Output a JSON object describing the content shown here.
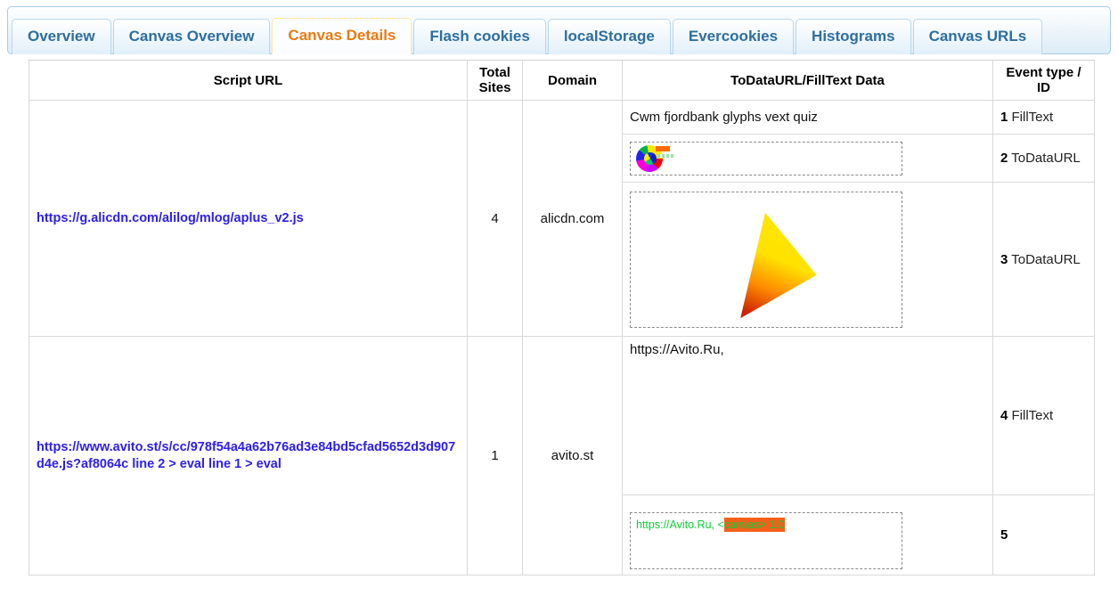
{
  "tabs": [
    {
      "label": "Overview",
      "selected": false
    },
    {
      "label": "Canvas Overview",
      "selected": false
    },
    {
      "label": "Canvas Details",
      "selected": true
    },
    {
      "label": "Flash cookies",
      "selected": false
    },
    {
      "label": "localStorage",
      "selected": false
    },
    {
      "label": "Evercookies",
      "selected": false
    },
    {
      "label": "Histograms",
      "selected": false
    },
    {
      "label": "Canvas URLs",
      "selected": false
    }
  ],
  "table": {
    "headers": {
      "script_url": "Script URL",
      "total_sites": "Total Sites",
      "domain": "Domain",
      "data": "ToDataURL/FillText Data",
      "event": "Event type / ID"
    },
    "groups": [
      {
        "script_url": "https://g.alicdn.com/alilog/mlog/aplus_v2.js",
        "total_sites": "4",
        "domain": "alicdn.com",
        "events": [
          {
            "id": "1",
            "type": "FillText",
            "kind": "text",
            "text": "Cwm fjordbank glyphs vext quiz"
          },
          {
            "id": "2",
            "type": "ToDataURL",
            "kind": "blob",
            "text": ""
          },
          {
            "id": "3",
            "type": "ToDataURL",
            "kind": "triangle",
            "text": ""
          }
        ]
      },
      {
        "script_url": "https://www.avito.st/s/cc/978f54a4a62b76ad3e84bd5cfad5652d3d907d4e.js?af8064c line 2 > eval line 1 > eval",
        "total_sites": "1",
        "domain": "avito.st",
        "events": [
          {
            "id": "4",
            "type": "FillText",
            "kind": "text",
            "text": "https://Avito.Ru,"
          },
          {
            "id": "5",
            "type": "",
            "kind": "greentext",
            "text": "https://Avito.Ru, <canvas> 1.0",
            "highlight": "canvas> 1.0",
            "prefix": "https://Avito.Ru, <"
          }
        ]
      }
    ]
  },
  "colors": {
    "link": "#2e20e8",
    "tab_text": "#2e6e9e",
    "tab_selected_text": "#e87b12",
    "green_text": "#14cc3a",
    "highlight": "#f4601a",
    "triangle_top": "#ffe600",
    "triangle_bottom": "#cc2200"
  }
}
